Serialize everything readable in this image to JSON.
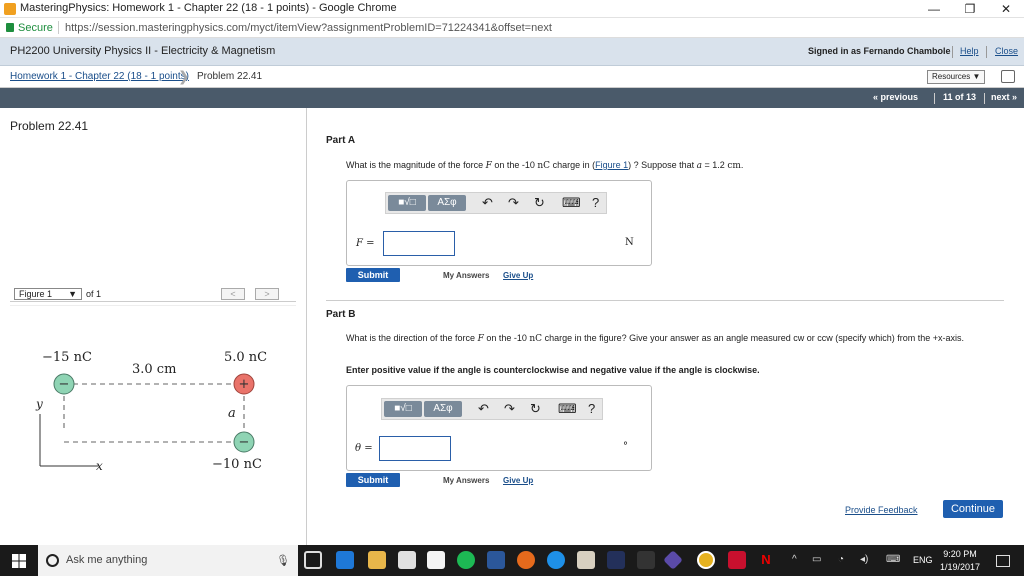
{
  "window": {
    "title": "MasteringPhysics: Homework 1 - Chapter 22 (18 - 1 points) - Google Chrome",
    "minimize": "—",
    "restore": "❐",
    "close": "✕"
  },
  "address": {
    "secure_label": "Secure",
    "url": "https://session.masteringphysics.com/myct/itemView?assignmentProblemID=71224341&offset=next"
  },
  "header": {
    "course": "PH2200 University Physics II - Electricity & Magnetism",
    "signed_in": "Signed in as Fernando Chambole",
    "help": "Help",
    "close": "Close"
  },
  "breadcrumb": {
    "assignment": "Homework 1 - Chapter 22 (18 - 1 points)",
    "chevron": "❯",
    "problem": "Problem 22.41",
    "resources": "Resources ▼",
    "print_icon": "printer-icon"
  },
  "nav": {
    "previous": "« previous",
    "position": "11 of 13",
    "next": "next »"
  },
  "left": {
    "problem_title": "Problem 22.41",
    "figure_select": "Figure 1",
    "figure_select_arrow": "▼",
    "of_label": "of 1",
    "prev_fig": "<",
    "next_fig": ">"
  },
  "figure": {
    "charge_top_left": "−15 nC",
    "charge_top_right": "5.0 nC",
    "distance": "3.0 cm",
    "a_label": "a",
    "y_label": "y",
    "x_label": "x",
    "charge_bottom_right": "−10 nC",
    "minus_sign": "−",
    "plus_sign": "+",
    "negative_color": "#8fd4b4",
    "positive_color": "#e9736a"
  },
  "partA": {
    "title": "Part A",
    "question_pre": "What is the magnitude of the force ",
    "force_symbol": "F",
    "question_mid": " on the -10 ",
    "unit_nc": "nC",
    "question_mid2": " charge in (",
    "figure_link": "Figure 1",
    "question_post": ") ? Suppose that ",
    "a_var": "a",
    "a_value": " = 1.2 ",
    "a_unit": "cm",
    "a_end": ".",
    "var_label": "F =",
    "unit": "N",
    "submit": "Submit",
    "my_answers": "My Answers",
    "give_up": "Give Up"
  },
  "partB": {
    "title": "Part B",
    "question_pre": "What is the direction of the force ",
    "force_symbol": "F",
    "question_mid": " on the -10 ",
    "unit_nc": "nC",
    "question_post": " charge in the figure? Give your answer as an angle measured cw or ccw (specify which) from the +x-axis.",
    "instruction": "Enter positive value if the angle is counterclockwise and negative value if the angle is clockwise.",
    "var_label": "θ =",
    "unit": "°",
    "submit": "Submit",
    "my_answers": "My Answers",
    "give_up": "Give Up"
  },
  "toolbar": {
    "templates": "■√□",
    "greek": "ΑΣφ",
    "undo": "↶",
    "redo": "↷",
    "reset": "↻",
    "keyboard": "⌨",
    "help": "?"
  },
  "footer": {
    "feedback": "Provide Feedback",
    "continue": "Continue"
  },
  "taskbar": {
    "search_placeholder": "Ask me anything",
    "mic": "🎙",
    "time": "9:20 PM",
    "date": "1/19/2017",
    "lang": "ENG",
    "tray_up": "^"
  }
}
